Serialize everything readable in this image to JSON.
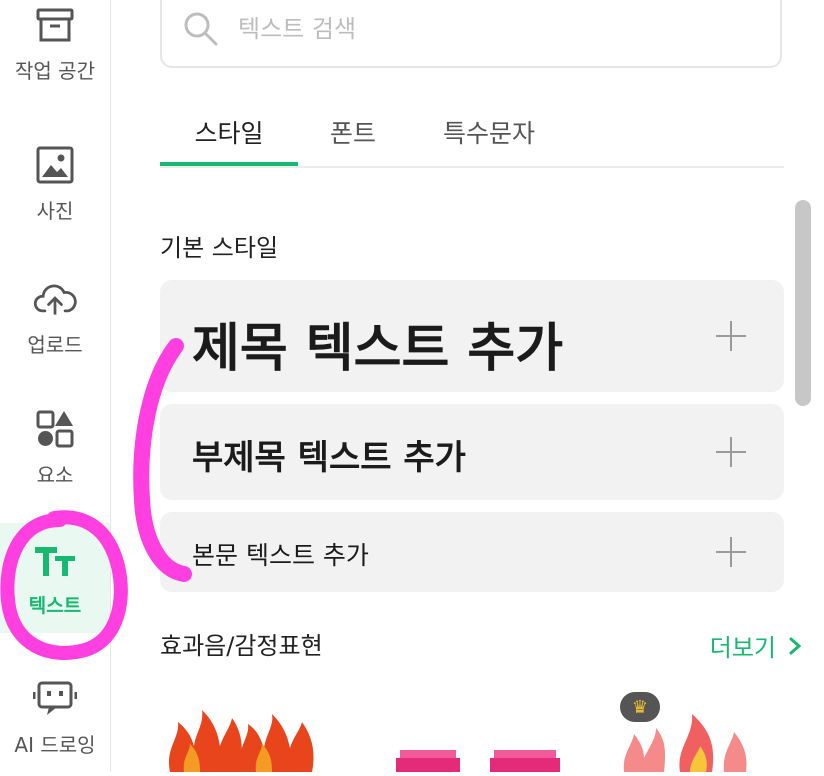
{
  "sidebar": {
    "items": [
      {
        "label": "작업 공간",
        "icon": "archive-box-icon"
      },
      {
        "label": "사진",
        "icon": "image-icon"
      },
      {
        "label": "업로드",
        "icon": "cloud-upload-icon"
      },
      {
        "label": "요소",
        "icon": "shapes-icon"
      },
      {
        "label": "텍스트",
        "icon": "text-tt-icon",
        "active": true
      },
      {
        "label": "AI 드로잉",
        "icon": "robot-icon"
      }
    ]
  },
  "search": {
    "placeholder": "텍스트 검색"
  },
  "tabs": [
    {
      "label": "스타일",
      "active": true
    },
    {
      "label": "폰트"
    },
    {
      "label": "특수문자"
    }
  ],
  "basic_styles": {
    "title": "기본 스타일",
    "items": [
      {
        "label": "제목 텍스트 추가"
      },
      {
        "label": "부제목 텍스트 추가"
      },
      {
        "label": "본문 텍스트 추가"
      }
    ]
  },
  "effects": {
    "title": "효과음/감정표현",
    "more_label": "더보기"
  },
  "colors": {
    "accent": "#17b870",
    "annotation": "#ff3fe0"
  }
}
